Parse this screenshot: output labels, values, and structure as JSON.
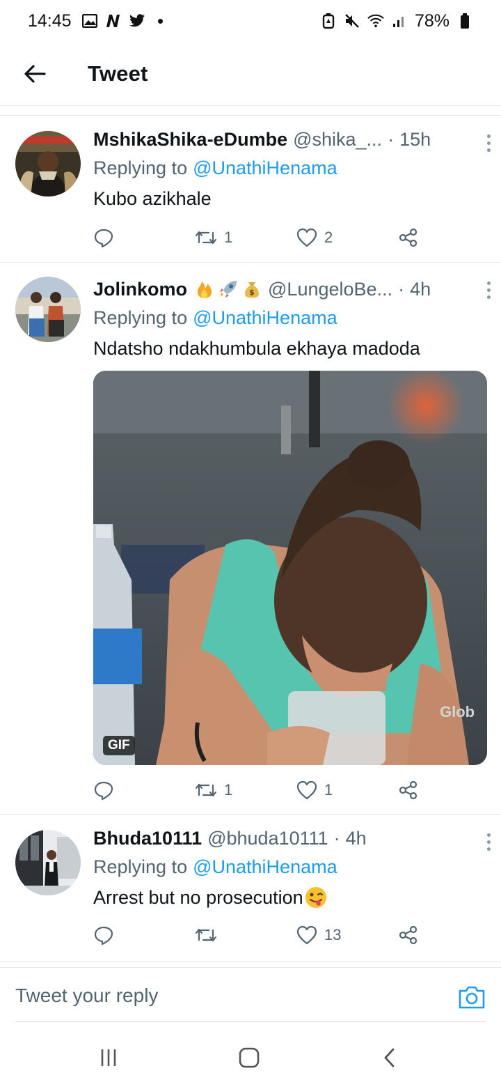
{
  "status_bar": {
    "time": "14:45",
    "battery": "78%",
    "left_icons": [
      "gallery-icon",
      "netflix-n-icon",
      "twitter-bird-icon",
      "dot-icon"
    ],
    "right_icons": [
      "battery-saver-icon",
      "mute-icon",
      "wifi-icon",
      "signal-icon",
      "battery-icon"
    ]
  },
  "header": {
    "title": "Tweet"
  },
  "tweets": [
    {
      "name": "MshikaShika-eDumbe",
      "handle": "@shika_...",
      "time": "15h",
      "replying_label": "Replying to",
      "replying_to": "@UnathiHenama",
      "text": "Kubo azikhale",
      "retweets": "1",
      "likes": "2"
    },
    {
      "name": "Jolinkomo",
      "name_emojis": [
        "fire-emoji",
        "rocket-emoji",
        "money-bag-emoji"
      ],
      "handle": "@LungeloBe...",
      "time": "4h",
      "replying_label": "Replying to",
      "replying_to": "@UnathiHenama",
      "text": "Ndatsho ndakhumbula ekhaya madoda",
      "media": {
        "type": "gif",
        "badge": "GIF",
        "watermark": "Glob"
      },
      "retweets": "1",
      "likes": "1"
    },
    {
      "name": "Bhuda10111",
      "handle": "@bhuda10111",
      "time": "4h",
      "replying_label": "Replying to",
      "replying_to": "@UnathiHenama",
      "text": "Arrest but no prosecution",
      "text_emoji": "winking-tongue-emoji",
      "retweets": "",
      "likes": "13"
    }
  ],
  "reply_bar": {
    "placeholder": "Tweet your reply"
  },
  "colors": {
    "accent": "#1d9bf0",
    "secondary_text": "#536471",
    "divider": "#e7e9ea"
  }
}
